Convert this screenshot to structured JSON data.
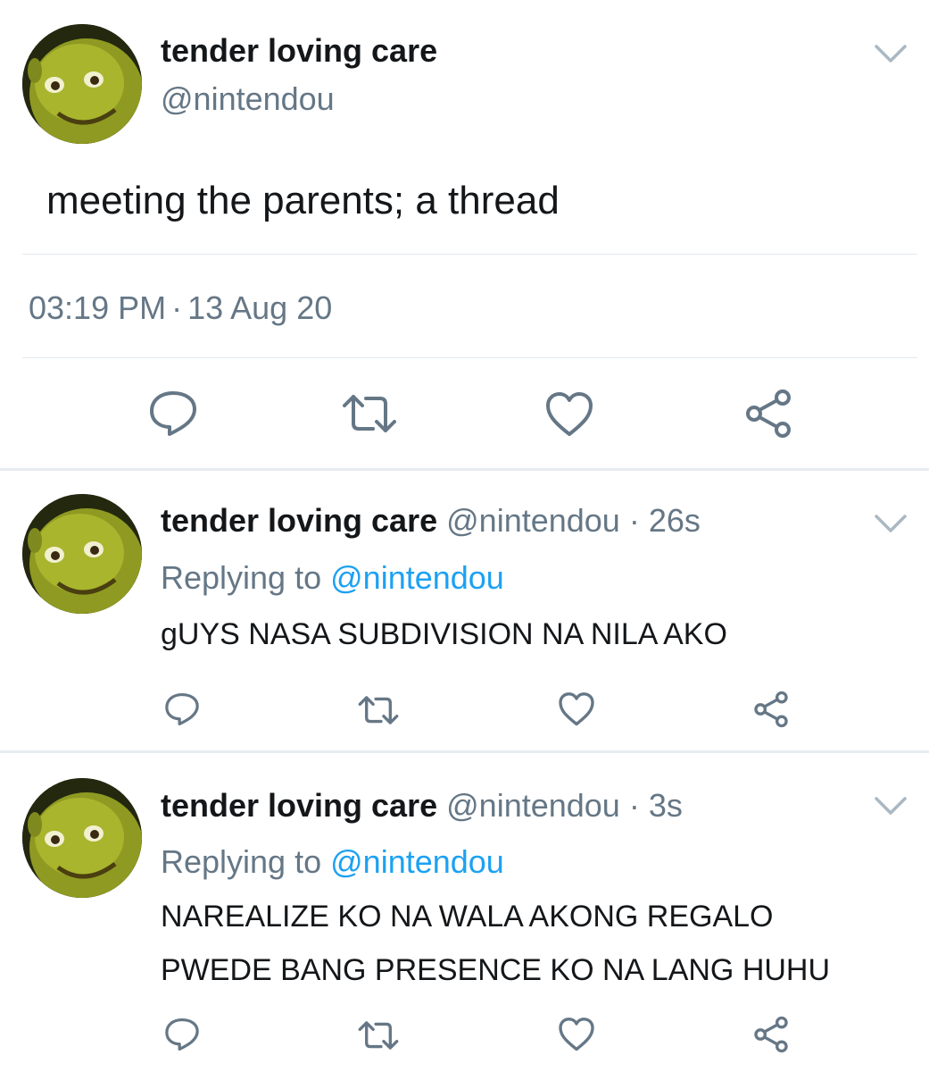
{
  "colors": {
    "text": "#14171a",
    "secondary": "#657786",
    "link": "#1da1f2",
    "icon": "#657786",
    "divider": "#e1e8ed"
  },
  "main_tweet": {
    "author_name": "tender loving care",
    "handle": "@nintendou",
    "text": "meeting the parents; a thread",
    "time": "03:19 PM",
    "separator": "·",
    "date": "13 Aug 20",
    "avatar_icon": "shrek-avatar",
    "menu_icon": "chevron-down-icon",
    "actions": [
      "reply-icon",
      "retweet-icon",
      "like-icon",
      "share-icon"
    ]
  },
  "replies": [
    {
      "author_name": "tender loving care",
      "handle": "@nintendou",
      "separator": "·",
      "age": "26s",
      "replying_prefix": "Replying to",
      "replying_to": "@nintendou",
      "text": "gUYS NASA SUBDIVISION NA NILA AKO"
    },
    {
      "author_name": "tender loving care",
      "handle": "@nintendou",
      "separator": "·",
      "age": "3s",
      "replying_prefix": "Replying to",
      "replying_to": "@nintendou",
      "text": "NAREALIZE KO NA WALA AKONG REGALO\nPWEDE BANG PRESENCE KO NA LANG HUHU"
    }
  ]
}
